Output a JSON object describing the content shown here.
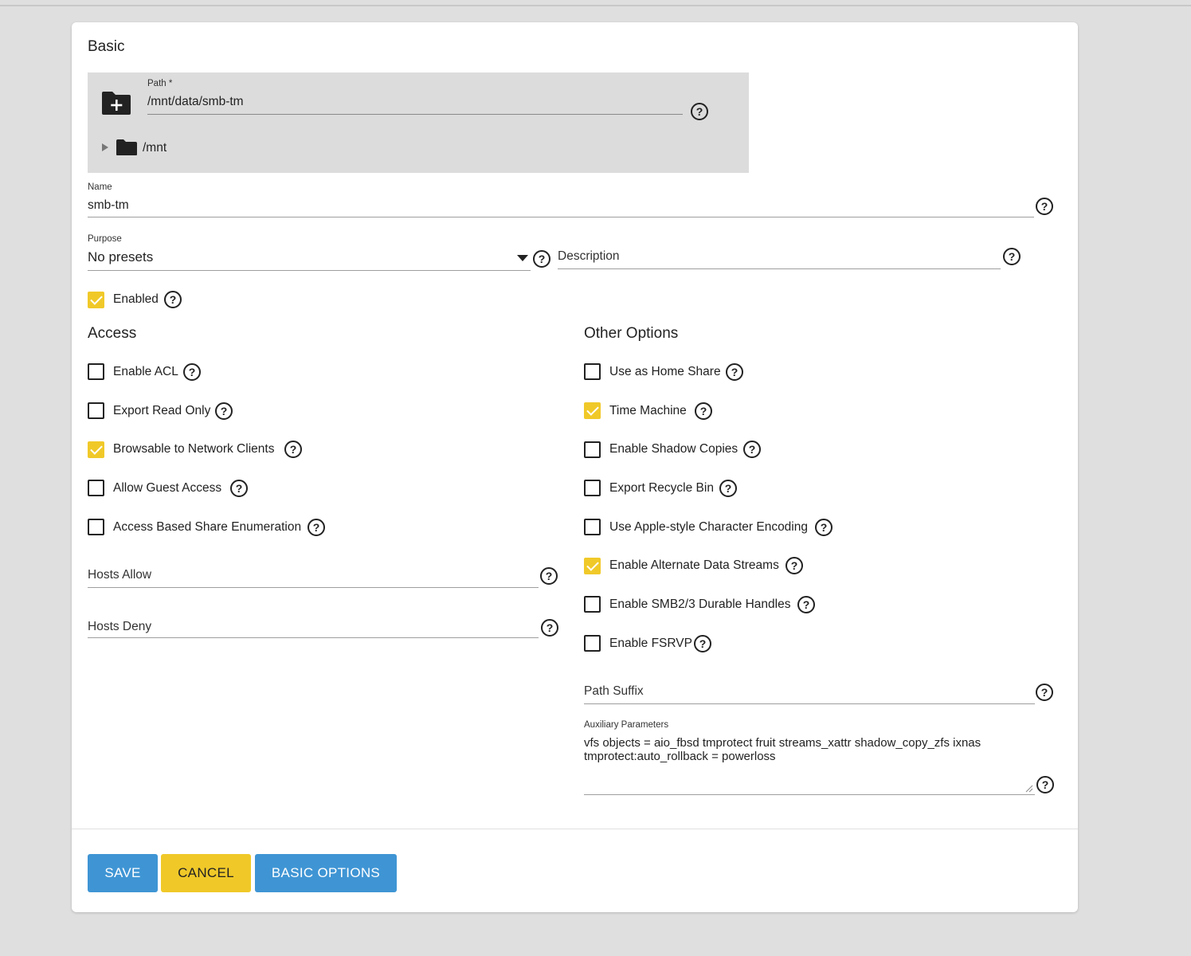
{
  "basic": {
    "title": "Basic",
    "path": {
      "label": "Path *",
      "value": "/mnt/data/smb-tm",
      "tree_root": "/mnt"
    },
    "name": {
      "label": "Name",
      "value": "smb-tm"
    },
    "purpose": {
      "label": "Purpose",
      "value": "No presets"
    },
    "description": {
      "placeholder": "Description",
      "value": ""
    },
    "enabled": {
      "label": "Enabled",
      "checked": true
    }
  },
  "access": {
    "title": "Access",
    "options": [
      {
        "label": "Enable ACL",
        "checked": false
      },
      {
        "label": "Export Read Only",
        "checked": false
      },
      {
        "label": "Browsable to Network Clients",
        "checked": true
      },
      {
        "label": "Allow Guest Access",
        "checked": false
      },
      {
        "label": "Access Based Share Enumeration",
        "checked": false
      }
    ],
    "hosts_allow": {
      "placeholder": "Hosts Allow"
    },
    "hosts_deny": {
      "placeholder": "Hosts Deny"
    }
  },
  "other": {
    "title": "Other Options",
    "options": [
      {
        "label": "Use as Home Share",
        "checked": false
      },
      {
        "label": "Time Machine",
        "checked": true
      },
      {
        "label": "Enable Shadow Copies",
        "checked": false
      },
      {
        "label": "Export Recycle Bin",
        "checked": false
      },
      {
        "label": "Use Apple-style Character Encoding",
        "checked": false
      },
      {
        "label": "Enable Alternate Data Streams",
        "checked": true
      },
      {
        "label": "Enable SMB2/3 Durable Handles",
        "checked": false
      },
      {
        "label": "Enable FSRVP",
        "checked": false
      }
    ],
    "path_suffix": {
      "placeholder": "Path Suffix"
    },
    "aux": {
      "label": "Auxiliary Parameters",
      "value": "vfs objects = aio_fbsd tmprotect fruit streams_xattr shadow_copy_zfs ixnas\ntmprotect:auto_rollback = powerloss"
    }
  },
  "buttons": {
    "save": "SAVE",
    "cancel": "CANCEL",
    "basic_options": "BASIC OPTIONS"
  },
  "icons": {
    "help": "help-circle-icon",
    "folder_add": "folder-plus-icon",
    "folder": "folder-icon",
    "expand": "triangle-right-icon",
    "dropdown": "caret-down-icon"
  },
  "colors": {
    "accent_blue": "#3f95d4",
    "accent_yellow": "#f0c929",
    "page_bg": "#dfdfdf"
  }
}
